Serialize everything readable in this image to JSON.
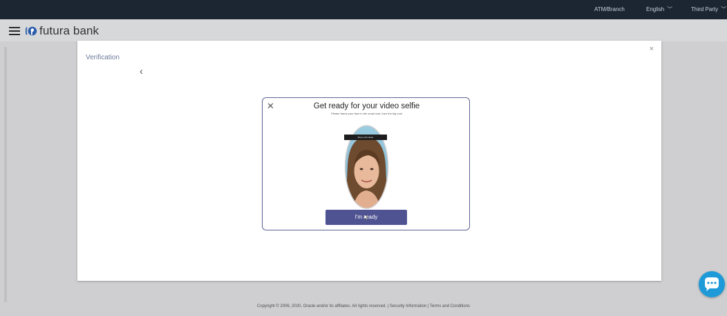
{
  "topbar": {
    "atm": "ATM/Branch",
    "language": "English",
    "third_party": "Third Party"
  },
  "header": {
    "logo_text": "futura bank"
  },
  "card": {
    "title": "Verification",
    "close": "×",
    "back": "‹"
  },
  "modal": {
    "close": "✕",
    "title": "Get ready for your video selfie",
    "subtitle": "Please frame your face in the small oval, then the big oval",
    "selfie_label": "Move a bit closer",
    "button_label": "I'm ready"
  },
  "footer": {
    "text": "Copyright © 2006, 2020, Oracle and/or its affiliates. All rights reserved. | Security Information | Terms and Conditions"
  },
  "icons": {
    "menu": "hamburger-menu-icon",
    "logo": "futura-bank-logo",
    "chat": "chat-bubble-icon"
  },
  "colors": {
    "topbar": "#1c2633",
    "page_background": "#cfcfd1",
    "modal_border": "#5a6391",
    "button": "#4f5392",
    "chat": "#1e9ad8",
    "title_text": "#6c7a9b"
  }
}
